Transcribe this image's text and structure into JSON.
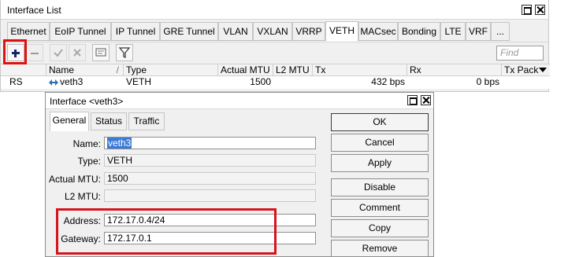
{
  "window": {
    "title": "Interface List",
    "tabs": [
      "Ethernet",
      "EoIP Tunnel",
      "IP Tunnel",
      "GRE Tunnel",
      "VLAN",
      "VXLAN",
      "VRRP",
      "VETH",
      "MACsec",
      "Bonding",
      "LTE",
      "VRF",
      "..."
    ],
    "active_tab": "VETH",
    "find_placeholder": "Find",
    "columns": [
      "",
      "Name",
      "Type",
      "Actual MTU",
      "L2 MTU",
      "Tx",
      "Rx",
      "Tx Pack"
    ],
    "sort_indicator": "/",
    "rows": [
      {
        "flags": "RS",
        "name": "veth3",
        "type": "VETH",
        "actual_mtu": "1500",
        "l2_mtu": "",
        "tx": "432 bps",
        "rx": "0 bps",
        "tx_pack": ""
      }
    ]
  },
  "dialog": {
    "title": "Interface <veth3>",
    "tabs": [
      "General",
      "Status",
      "Traffic"
    ],
    "active_tab": "General",
    "fields": {
      "name": {
        "label": "Name:",
        "value": "veth3"
      },
      "type": {
        "label": "Type:",
        "value": "VETH"
      },
      "actual_mtu": {
        "label": "Actual MTU:",
        "value": "1500"
      },
      "l2_mtu": {
        "label": "L2 MTU:",
        "value": ""
      },
      "address": {
        "label": "Address:",
        "value": "172.17.0.4/24"
      },
      "gateway": {
        "label": "Gateway:",
        "value": "172.17.0.1"
      }
    },
    "buttons": [
      "OK",
      "Cancel",
      "Apply",
      "Disable",
      "Comment",
      "Copy",
      "Remove"
    ]
  },
  "colors": {
    "highlight": "#e01010",
    "selection": "#3b7bd6",
    "add_icon": "#13246b"
  },
  "icons": [
    "add-icon",
    "remove-icon",
    "enable-icon",
    "disable-icon",
    "comment-icon",
    "filter-icon",
    "dropdown-arrow-icon",
    "interface-icon"
  ]
}
